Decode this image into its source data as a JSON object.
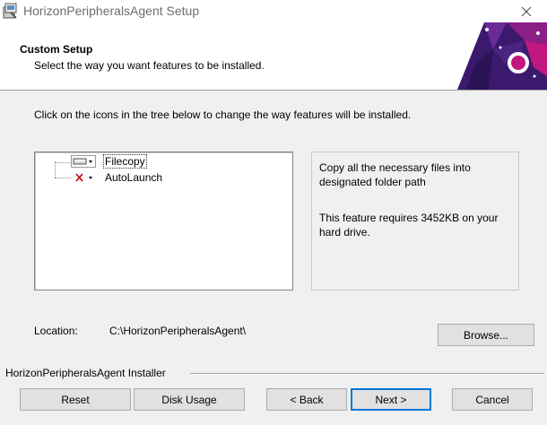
{
  "window": {
    "title": "HorizonPeripheralsAgent Setup",
    "app_icon": "installer-box-icon",
    "close_icon": "close-icon"
  },
  "banner": {
    "title": "Custom Setup",
    "subtitle": "Select the way you want features to be installed.",
    "art": "banner-graphic"
  },
  "instruction": "Click on the icons in the tree below to change the way features will be installed.",
  "features": [
    {
      "label": "Filecopy",
      "state": "install-local",
      "icon": "drive-icon",
      "selected": true
    },
    {
      "label": "AutoLaunch",
      "state": "not-available",
      "icon": "red-x-icon",
      "selected": false
    }
  ],
  "description": {
    "text": "Copy all the necessary files into designated folder path",
    "requirement": "This feature requires 3452KB on your hard drive."
  },
  "location": {
    "label": "Location:",
    "value": "C:\\HorizonPeripheralsAgent\\"
  },
  "buttons": {
    "browse": "Browse...",
    "reset": "Reset",
    "disk_usage": "Disk Usage",
    "back": "< Back",
    "next": "Next >",
    "cancel": "Cancel"
  },
  "installer_label": "HorizonPeripheralsAgent Installer",
  "colors": {
    "accent": "#0078d7",
    "banner_purple": "#3b1a6e",
    "banner_magenta": "#c2177e"
  }
}
